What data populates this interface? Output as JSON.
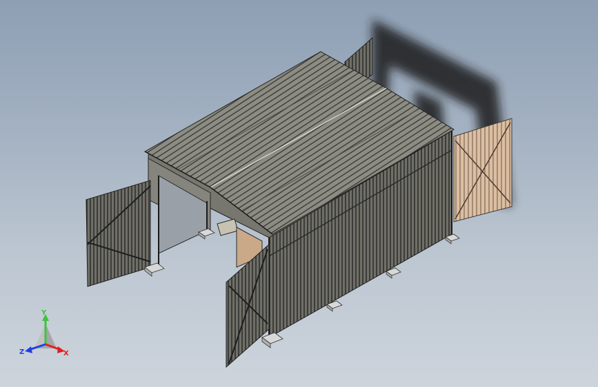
{
  "viewport": {
    "background_top": "#8e9fb4",
    "background_bottom": "#cdd4dc"
  },
  "triad": {
    "y_label": "Y",
    "x_label": "X",
    "z_label": "Z",
    "y_color": "#3ec43e",
    "x_color": "#e02020",
    "z_color": "#2040e0"
  },
  "model": {
    "roof_color": "#8a8a80",
    "wall_color": "#6e6e68",
    "panel_line_color": "#2a2a2a",
    "inner_door_color": "#d8b89a",
    "shadow_color": "#1e1e1e"
  }
}
